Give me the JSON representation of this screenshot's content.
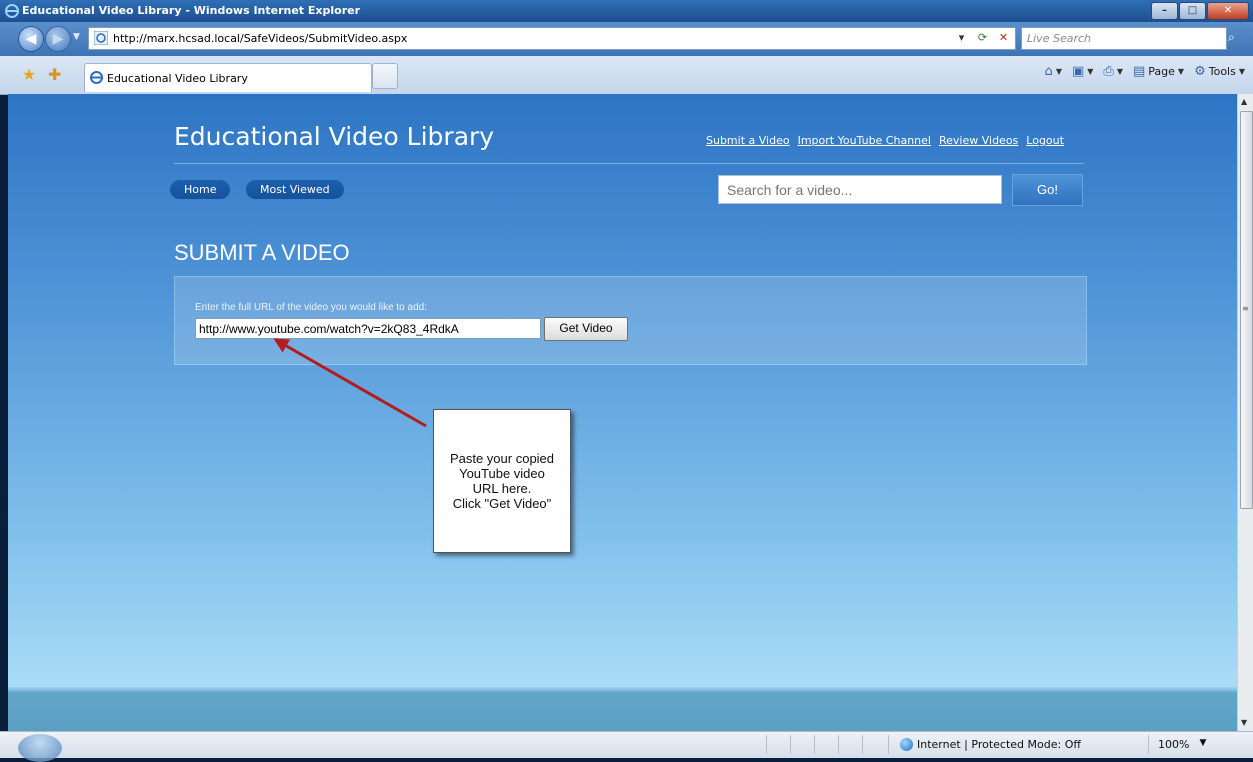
{
  "window": {
    "title": "Educational Video Library - Windows Internet Explorer",
    "buttons": {
      "minimize": "–",
      "maximize": "□",
      "close": "✕"
    }
  },
  "browser": {
    "url": "http://marx.hcsad.local/SafeVideos/SubmitVideo.aspx",
    "search_placeholder": "Live Search",
    "tab_label": "Educational Video Library",
    "commands": {
      "page": "Page",
      "tools": "Tools"
    }
  },
  "site": {
    "title": "Educational Video Library",
    "top_links": [
      "Submit a Video",
      "Import YouTube Channel",
      "Review Videos",
      "Logout"
    ],
    "nav": [
      "Home",
      "Most Viewed"
    ],
    "search_placeholder": "Search for a video...",
    "search_button": "Go!"
  },
  "page": {
    "title": "SUBMIT A VIDEO",
    "instruction": "Enter the full URL of the video you would like to add:",
    "url_value": "http://www.youtube.com/watch?v=2kQ83_4RdkA",
    "submit_label": "Get Video"
  },
  "callout": {
    "text": "Paste your copied\nYouTube video\nURL here.\nClick \"Get Video\""
  },
  "status": {
    "zone": "Internet | Protected Mode: Off",
    "zoom": "100%"
  },
  "colors": {
    "arrow": "#b31d1d",
    "nav_pill": "#165299",
    "page_bg_top": "#2d74c4",
    "page_bg_bottom": "#a9dcf6"
  }
}
